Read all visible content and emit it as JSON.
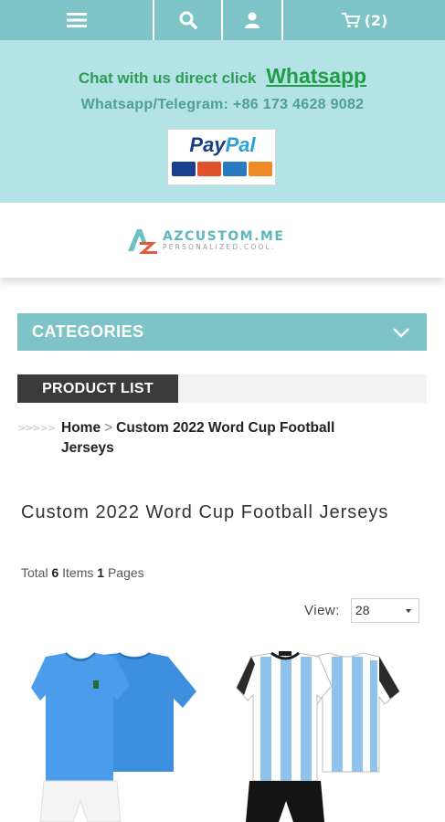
{
  "topnav": {
    "cart_count": "(2)",
    "icons": [
      "menu-icon",
      "search-icon",
      "user-icon",
      "cart-icon"
    ]
  },
  "banner": {
    "chat_text": "Chat with us direct click",
    "whatsapp_link": "Whatsapp",
    "telegram_text": "Whatsapp/Telegram: +86 173 4628 9082",
    "paypal": {
      "pay": "Pay",
      "pal": "Pal"
    }
  },
  "logo": {
    "name": "AZCUSTOM.ME",
    "tagline": "PERSONALIZED.COOL."
  },
  "categories": {
    "label": "CATEGORIES"
  },
  "product_list": {
    "label": "PRODUCT LIST"
  },
  "breadcrumb": {
    "home": "Home",
    "separator": ">",
    "current": "Custom 2022 Word Cup Football Jerseys"
  },
  "page": {
    "title": "Custom 2022 Word Cup Football Jerseys",
    "total_prefix": "Total",
    "items_count": "6",
    "items_label": "Items",
    "pages_count": "1",
    "pages_label": "Pages"
  },
  "view": {
    "label": "View:",
    "selected": "28"
  },
  "colors": {
    "accent": "#7ec3c6",
    "banner_bg": "#b3e3e6",
    "whatsapp_green": "#2e9d53",
    "dark_label": "#3b3b3b"
  },
  "products": [
    {
      "image": "blue jersey kit"
    },
    {
      "image": "light blue and white striped jersey kit"
    }
  ]
}
